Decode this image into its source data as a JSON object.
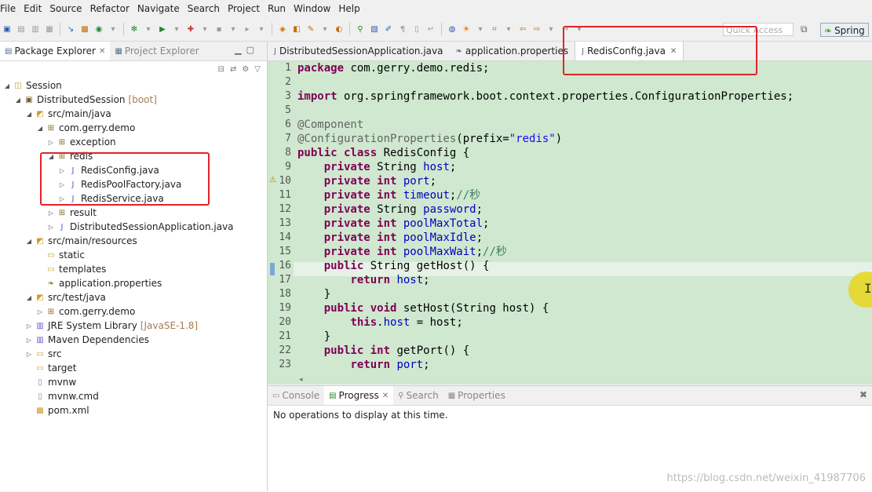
{
  "menu": [
    "File",
    "Edit",
    "Source",
    "Refactor",
    "Navigate",
    "Search",
    "Project",
    "Run",
    "Window",
    "Help"
  ],
  "toolbar": {
    "quick_access_placeholder": "Quick Access",
    "perspective_label": "Spring"
  },
  "explorer": {
    "tab_active": "Package Explorer",
    "tab_inactive": "Project Explorer",
    "tree": {
      "session": "Session",
      "project": "DistributedSession",
      "project_decorator": "[boot]",
      "src_main_java": "src/main/java",
      "pkg_demo": "com.gerry.demo",
      "pkg_exception": "exception",
      "pkg_redis": "redis",
      "file_redisconfig": "RedisConfig.java",
      "file_redispoolfactory": "RedisPoolFactory.java",
      "file_redisservice": "RedisService.java",
      "pkg_result": "result",
      "file_app": "DistributedSessionApplication.java",
      "src_main_resources": "src/main/resources",
      "folder_static": "static",
      "folder_templates": "templates",
      "file_app_props": "application.properties",
      "src_test_java": "src/test/java",
      "pkg_demo_test": "com.gerry.demo",
      "jre": "JRE System Library",
      "jre_decorator": "[JavaSE-1.8]",
      "maven": "Maven Dependencies",
      "folder_src": "src",
      "folder_target": "target",
      "file_mvnw": "mvnw",
      "file_mvnw_cmd": "mvnw.cmd",
      "file_pom": "pom.xml"
    }
  },
  "editor": {
    "tabs": [
      "DistributedSessionApplication.java",
      "application.properties",
      "RedisConfig.java"
    ],
    "line_numbers": [
      "1",
      "2",
      "3",
      "5",
      "6",
      "7",
      "8",
      "9",
      "10",
      "11",
      "12",
      "13",
      "14",
      "15",
      "16",
      "17",
      "18",
      "19",
      "20",
      "21",
      "22",
      "23"
    ],
    "code": {
      "l1_kw": "package",
      "l1_rest": " com.gerry.demo.redis;",
      "l3_kw": "import",
      "l3_rest": " org.springframework.boot.context.properties.ConfigurationProperties;",
      "l6_ann": "@Component",
      "l7_ann": "@ConfigurationProperties",
      "l7_a": "(prefix=",
      "l7_str": "\"redis\"",
      "l7_b": ")",
      "l8_kw": "public class",
      "l8_rest": " RedisConfig {",
      "l9_kw": "private",
      "l9_a": " String ",
      "l9_fld": "host",
      "l10_kw": "private int",
      "l10_fld": "port",
      "l11_kw": "private int",
      "l11_fld": "timeout",
      "l11_cmt": "//秒",
      "l12_kw": "private",
      "l12_a": " String ",
      "l12_fld": "password",
      "l13_kw": "private int",
      "l13_fld": "poolMaxTotal",
      "l14_kw": "private int",
      "l14_fld": "poolMaxIdle",
      "l15_kw": "private int",
      "l15_fld": "poolMaxWait",
      "l15_cmt": "//秒",
      "l16_kw": "public",
      "l16_rest": " String getHost() {",
      "l17_kw": "return",
      "l17_fld": "host",
      "l18": "}",
      "l19_kw": "public void",
      "l19_rest": " setHost(String host) {",
      "l20_kw": "this",
      "l20_fld": "host",
      "l20_rest": " = host;",
      "l21": "}",
      "l22_kw": "public int",
      "l22_rest": " getPort() {",
      "l23_kw": "return",
      "l23_fld": "port"
    }
  },
  "bottom": {
    "tabs": [
      "Console",
      "Progress",
      "Search",
      "Properties"
    ],
    "message": "No operations to display at this time."
  },
  "watermark": "https://blog.csdn.net/weixin_41987706",
  "colors": {
    "highlight_box": "#e0242a",
    "editor_bg": "#cfe8cf",
    "keyword": "#7f0055",
    "field": "#0000c0",
    "string": "#2a00ff",
    "comment": "#3f7f5f",
    "cursor_halo": "#e8d61c"
  }
}
